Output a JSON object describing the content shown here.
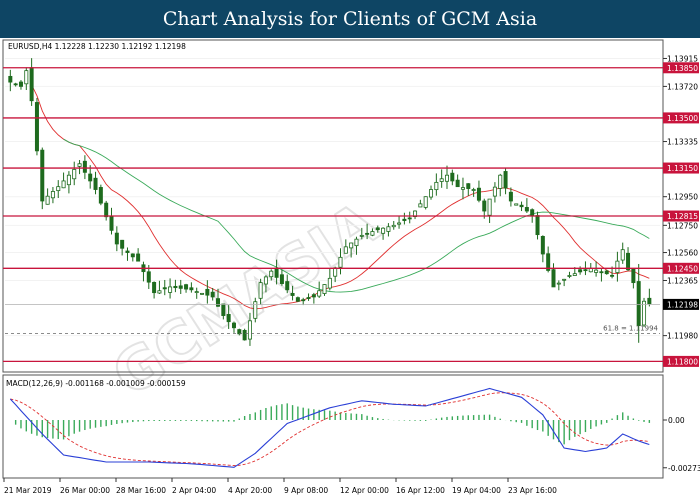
{
  "header": {
    "title": "Chart Analysis for Clients of GCM Asia"
  },
  "watermark": "GCMASIA",
  "chart_data": {
    "type": "candlestick",
    "symbol_line": "EURUSD,H4  1.12228 1.12230 1.12192 1.12198",
    "price_axis": {
      "ylim": [
        1.1174,
        1.1403
      ],
      "ticks": [
        "1.13915",
        "1.13720",
        "1.13335",
        "1.12950",
        "1.12750",
        "1.12560",
        "1.12365",
        "1.11980",
        "1.11800"
      ]
    },
    "resistance_lines": [
      {
        "label": "1.13850",
        "value": 1.1385
      },
      {
        "label": "1.13500",
        "value": 1.135
      },
      {
        "label": "1.13150",
        "value": 1.1315
      },
      {
        "label": "1.12815",
        "value": 1.12815
      },
      {
        "label": "1.12450",
        "value": 1.1245
      },
      {
        "label": "1.11800",
        "value": 1.118
      }
    ],
    "fibonacci": {
      "label": "61.8 = 1.11994",
      "value": 1.11994
    },
    "current_price": {
      "label": "1.12198",
      "value": 1.12198
    },
    "x_labels": [
      "21 Mar 2019",
      "26 Mar 00:00",
      "28 Mar 16:00",
      "2 Apr 04:00",
      "4 Apr 20:00",
      "9 Apr 08:00",
      "12 Apr 00:00",
      "16 Apr 12:00",
      "19 Apr 04:00",
      "23 Apr 16:00"
    ],
    "close_anchors": [
      [
        0,
        1.1375
      ],
      [
        2,
        1.1372
      ],
      [
        3,
        1.1383
      ],
      [
        4,
        1.1362
      ],
      [
        6,
        1.1292
      ],
      [
        9,
        1.1302
      ],
      [
        13,
        1.1318
      ],
      [
        16,
        1.13
      ],
      [
        20,
        1.1262
      ],
      [
        24,
        1.125
      ],
      [
        27,
        1.1228
      ],
      [
        30,
        1.1232
      ],
      [
        34,
        1.123
      ],
      [
        38,
        1.1225
      ],
      [
        40,
        1.1212
      ],
      [
        44,
        1.1195
      ],
      [
        47,
        1.1235
      ],
      [
        49,
        1.1243
      ],
      [
        52,
        1.123
      ],
      [
        54,
        1.1222
      ],
      [
        57,
        1.1225
      ],
      [
        60,
        1.1238
      ],
      [
        63,
        1.126
      ],
      [
        66,
        1.1268
      ],
      [
        69,
        1.1272
      ],
      [
        72,
        1.1275
      ],
      [
        75,
        1.128
      ],
      [
        78,
        1.1295
      ],
      [
        80,
        1.1305
      ],
      [
        82,
        1.131
      ],
      [
        84,
        1.1302
      ],
      [
        87,
        1.13
      ],
      [
        89,
        1.1285
      ],
      [
        92,
        1.131
      ],
      [
        94,
        1.1292
      ],
      [
        96,
        1.1288
      ],
      [
        98,
        1.1282
      ],
      [
        100,
        1.1255
      ],
      [
        102,
        1.1232
      ],
      [
        105,
        1.124
      ],
      [
        109,
        1.1245
      ],
      [
        113,
        1.124
      ],
      [
        114,
        1.125
      ],
      [
        115,
        1.1258
      ],
      [
        116,
        1.1244
      ],
      [
        117,
        1.1235
      ],
      [
        118,
        1.1205
      ],
      [
        119,
        1.1222
      ],
      [
        120,
        1.122
      ]
    ],
    "moving_averages": [
      {
        "name": "MA red",
        "color": "#e03030"
      },
      {
        "name": "MA green",
        "color": "#3aaa5a"
      }
    ],
    "macd": {
      "label": "MACD(12,26,9) -0.001168 -0.001009 -0.000159",
      "ticks": [
        "0.00",
        "-0.00273"
      ],
      "ylim": [
        -0.0032,
        0.0024
      ],
      "macd_anchors": [
        [
          0,
          0.0012
        ],
        [
          6,
          -0.0008
        ],
        [
          10,
          -0.002
        ],
        [
          18,
          -0.0024
        ],
        [
          26,
          -0.0024
        ],
        [
          34,
          -0.0025
        ],
        [
          42,
          -0.0027
        ],
        [
          46,
          -0.0019
        ],
        [
          52,
          -0.0002
        ],
        [
          60,
          0.0007
        ],
        [
          66,
          0.0011
        ],
        [
          72,
          0.0009
        ],
        [
          78,
          0.0008
        ],
        [
          84,
          0.0013
        ],
        [
          90,
          0.0018
        ],
        [
          96,
          0.0013
        ],
        [
          100,
          0.0003
        ],
        [
          104,
          -0.0016
        ],
        [
          108,
          -0.0018
        ],
        [
          112,
          -0.0016
        ],
        [
          115,
          -0.0008
        ],
        [
          118,
          -0.0012
        ],
        [
          120,
          -0.0014
        ]
      ],
      "signal_color": "#e03030",
      "macd_color": "#2a3fd6",
      "histogram_color": "#3aaa5a"
    }
  },
  "colors": {
    "header_bg": "#0e4564",
    "resistance": "#c8143c",
    "candle": "#1e6b1e"
  }
}
